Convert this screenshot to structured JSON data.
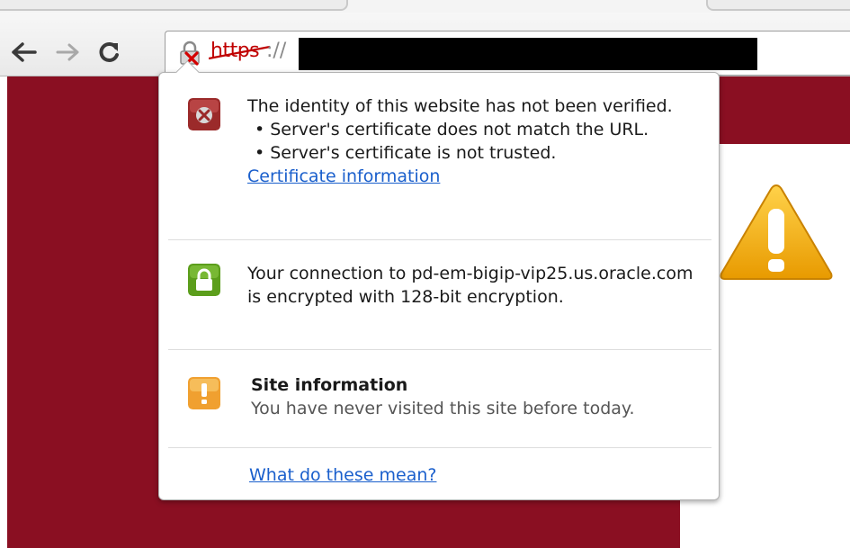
{
  "browser": {
    "url_scheme": "https",
    "url_separator": "://",
    "icons": {
      "back": "arrow-left-icon",
      "forward": "arrow-right-icon",
      "reload": "reload-icon",
      "security": "broken-lock-icon"
    }
  },
  "popup": {
    "identity": {
      "heading": "The identity of this website has not been verified.",
      "bullets": [
        "• Server's certificate does not match the URL.",
        "• Server's certificate is not trusted."
      ],
      "link": "Certificate information"
    },
    "connection": {
      "text": "Your connection to pd-em-bigip-vip25.us.oracle.com is encrypted with 128-bit encryption."
    },
    "site_info": {
      "title": "Site information",
      "text": "You have never visited this site before today."
    },
    "help_link": "What do these mean?"
  },
  "colors": {
    "page_brand": "#8a0f22",
    "error_red": "#c00000",
    "link_blue": "#1a5fcc",
    "secure_green": "#5c9e1c",
    "warning_orange": "#f0a030"
  }
}
